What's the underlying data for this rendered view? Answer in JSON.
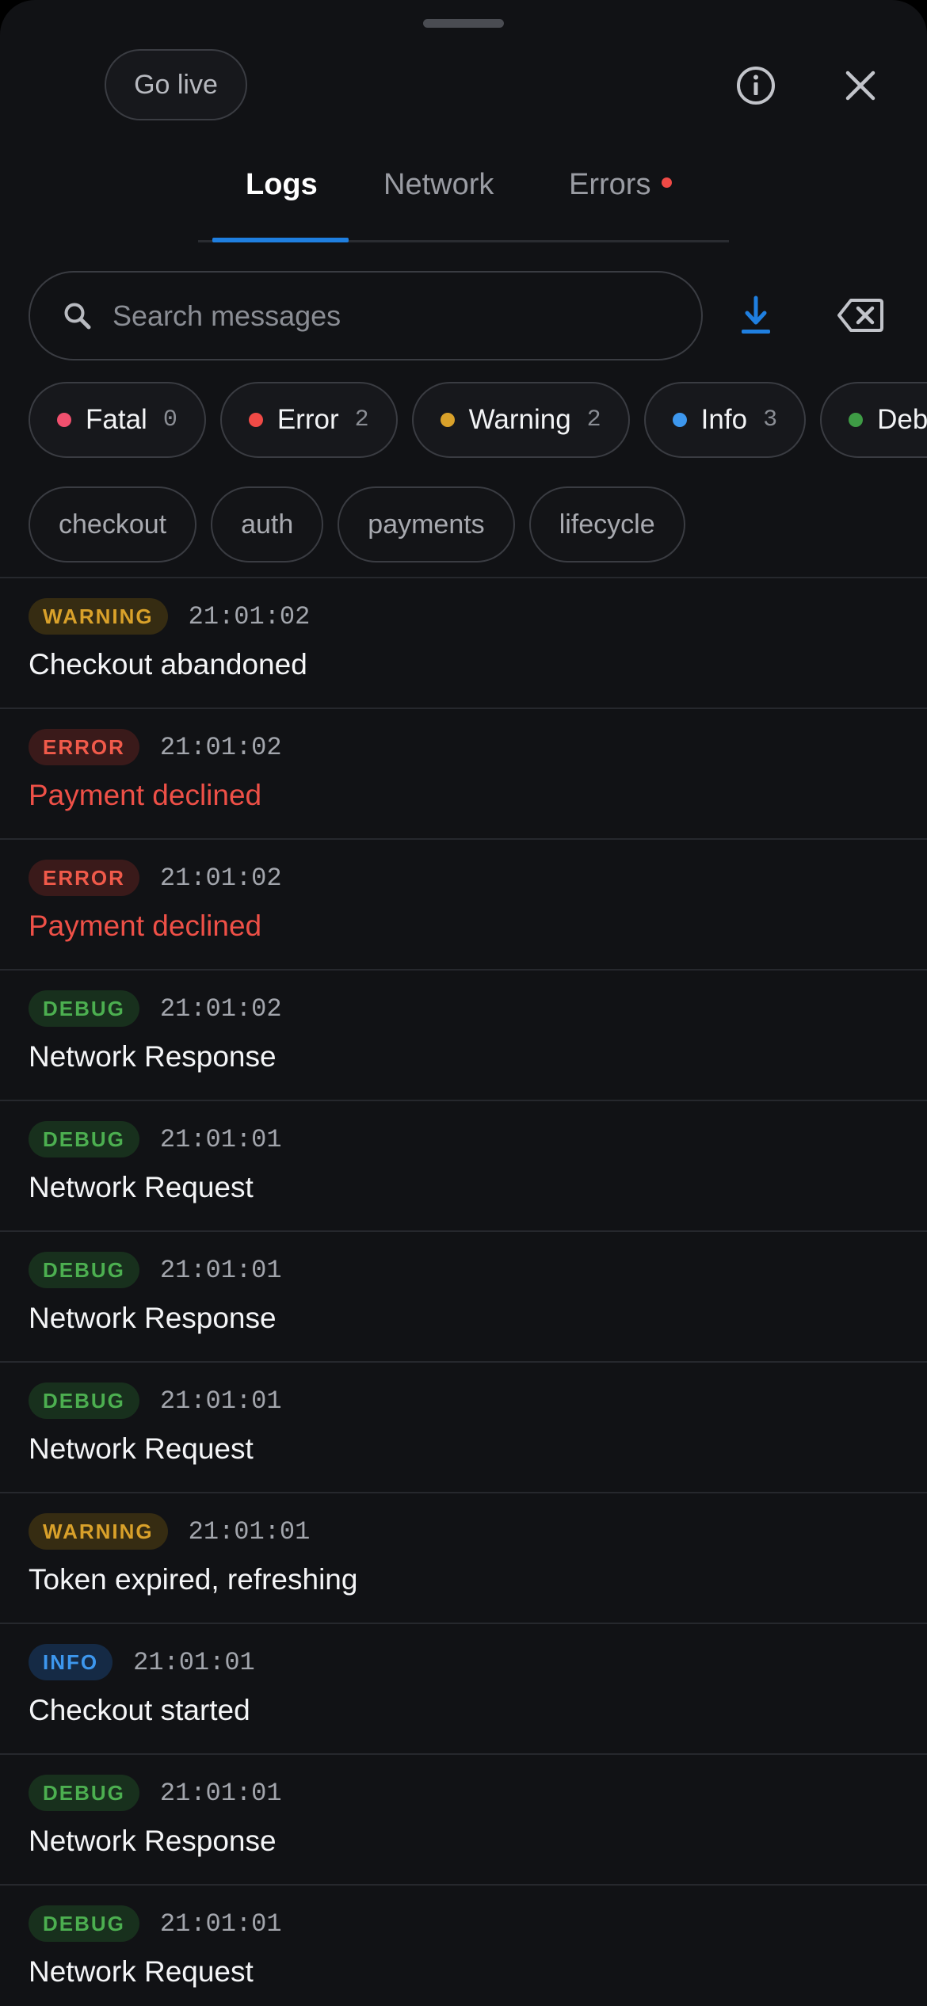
{
  "header": {
    "go_live_label": "Go live",
    "info_icon": "info-icon",
    "close_icon": "close-icon"
  },
  "tabs": [
    {
      "label": "Logs",
      "active": true
    },
    {
      "label": "Network",
      "active": false
    },
    {
      "label": "Errors",
      "active": false,
      "has_alert": true
    }
  ],
  "search": {
    "placeholder": "Search messages",
    "value": "",
    "download_icon": "download-icon",
    "clear_icon": "backspace-icon"
  },
  "level_filters": [
    {
      "label": "Fatal",
      "count": "0",
      "color": "#f0506e"
    },
    {
      "label": "Error",
      "count": "2",
      "color": "#f04a46"
    },
    {
      "label": "Warning",
      "count": "2",
      "color": "#d9a12a"
    },
    {
      "label": "Info",
      "count": "3",
      "color": "#3d97ee"
    },
    {
      "label": "Debug",
      "count": "",
      "color": "#3e9b45"
    }
  ],
  "tag_filters": [
    "checkout",
    "auth",
    "payments",
    "lifecycle"
  ],
  "colors": {
    "accent": "#1f7fe0",
    "background": "#111215",
    "warning": "#d9a12a",
    "error": "#f05a4a",
    "debug": "#4caf50",
    "info": "#3d97ee"
  },
  "logs": [
    {
      "level": "WARNING",
      "time": "21:01:02",
      "message": "Checkout abandoned"
    },
    {
      "level": "ERROR",
      "time": "21:01:02",
      "message": "Payment declined"
    },
    {
      "level": "ERROR",
      "time": "21:01:02",
      "message": "Payment declined"
    },
    {
      "level": "DEBUG",
      "time": "21:01:02",
      "message": "Network Response"
    },
    {
      "level": "DEBUG",
      "time": "21:01:01",
      "message": "Network Request"
    },
    {
      "level": "DEBUG",
      "time": "21:01:01",
      "message": "Network Response"
    },
    {
      "level": "DEBUG",
      "time": "21:01:01",
      "message": "Network Request"
    },
    {
      "level": "WARNING",
      "time": "21:01:01",
      "message": "Token expired, refreshing"
    },
    {
      "level": "INFO",
      "time": "21:01:01",
      "message": "Checkout started"
    },
    {
      "level": "DEBUG",
      "time": "21:01:01",
      "message": "Network Response"
    },
    {
      "level": "DEBUG",
      "time": "21:01:01",
      "message": "Network Request"
    }
  ]
}
